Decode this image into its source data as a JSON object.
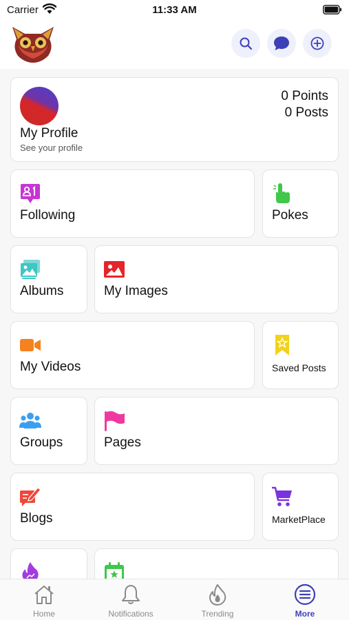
{
  "status_bar": {
    "carrier": "Carrier",
    "time": "11:33 AM"
  },
  "header": {
    "logo": "owl-logo",
    "actions": [
      {
        "icon": "search-icon"
      },
      {
        "icon": "chat-bubble-icon"
      },
      {
        "icon": "add-circle-icon"
      }
    ],
    "accent_color": "#3d3fb8"
  },
  "profile": {
    "name": "My Profile",
    "subtitle": "See your profile",
    "points": "0 Points",
    "posts": "0 Posts"
  },
  "menu": [
    {
      "label": "Following",
      "icon": "following-badge-icon",
      "color": "#c934d6"
    },
    {
      "label": "Pokes",
      "icon": "poke-hand-icon",
      "color": "#3fc84a"
    },
    {
      "label": "Albums",
      "icon": "albums-icon",
      "color": "#3ec6c3"
    },
    {
      "label": "My Images",
      "icon": "image-icon",
      "color": "#e5252a"
    },
    {
      "label": "My Videos",
      "icon": "video-camera-icon",
      "color": "#f5821f"
    },
    {
      "label": "Saved Posts",
      "icon": "bookmark-star-icon",
      "color": "#f2d21b"
    },
    {
      "label": "Groups",
      "icon": "groups-icon",
      "color": "#3a9ff0"
    },
    {
      "label": "Pages",
      "icon": "flag-icon",
      "color": "#ee3aa0"
    },
    {
      "label": "Blogs",
      "icon": "blog-edit-icon",
      "color": "#f0473a"
    },
    {
      "label": "MarketPlace",
      "icon": "cart-icon",
      "color": "#7b33e0"
    },
    {
      "label": "",
      "icon": "fire-icon",
      "color": "#a23ce0"
    },
    {
      "label": "",
      "icon": "calendar-star-icon",
      "color": "#3cc84a"
    }
  ],
  "tabs": [
    {
      "label": "Home",
      "icon": "home-icon",
      "active": false
    },
    {
      "label": "Notifications",
      "icon": "bell-icon",
      "active": false
    },
    {
      "label": "Trending",
      "icon": "flame-icon",
      "active": false
    },
    {
      "label": "More",
      "icon": "menu-circle-icon",
      "active": true
    }
  ]
}
